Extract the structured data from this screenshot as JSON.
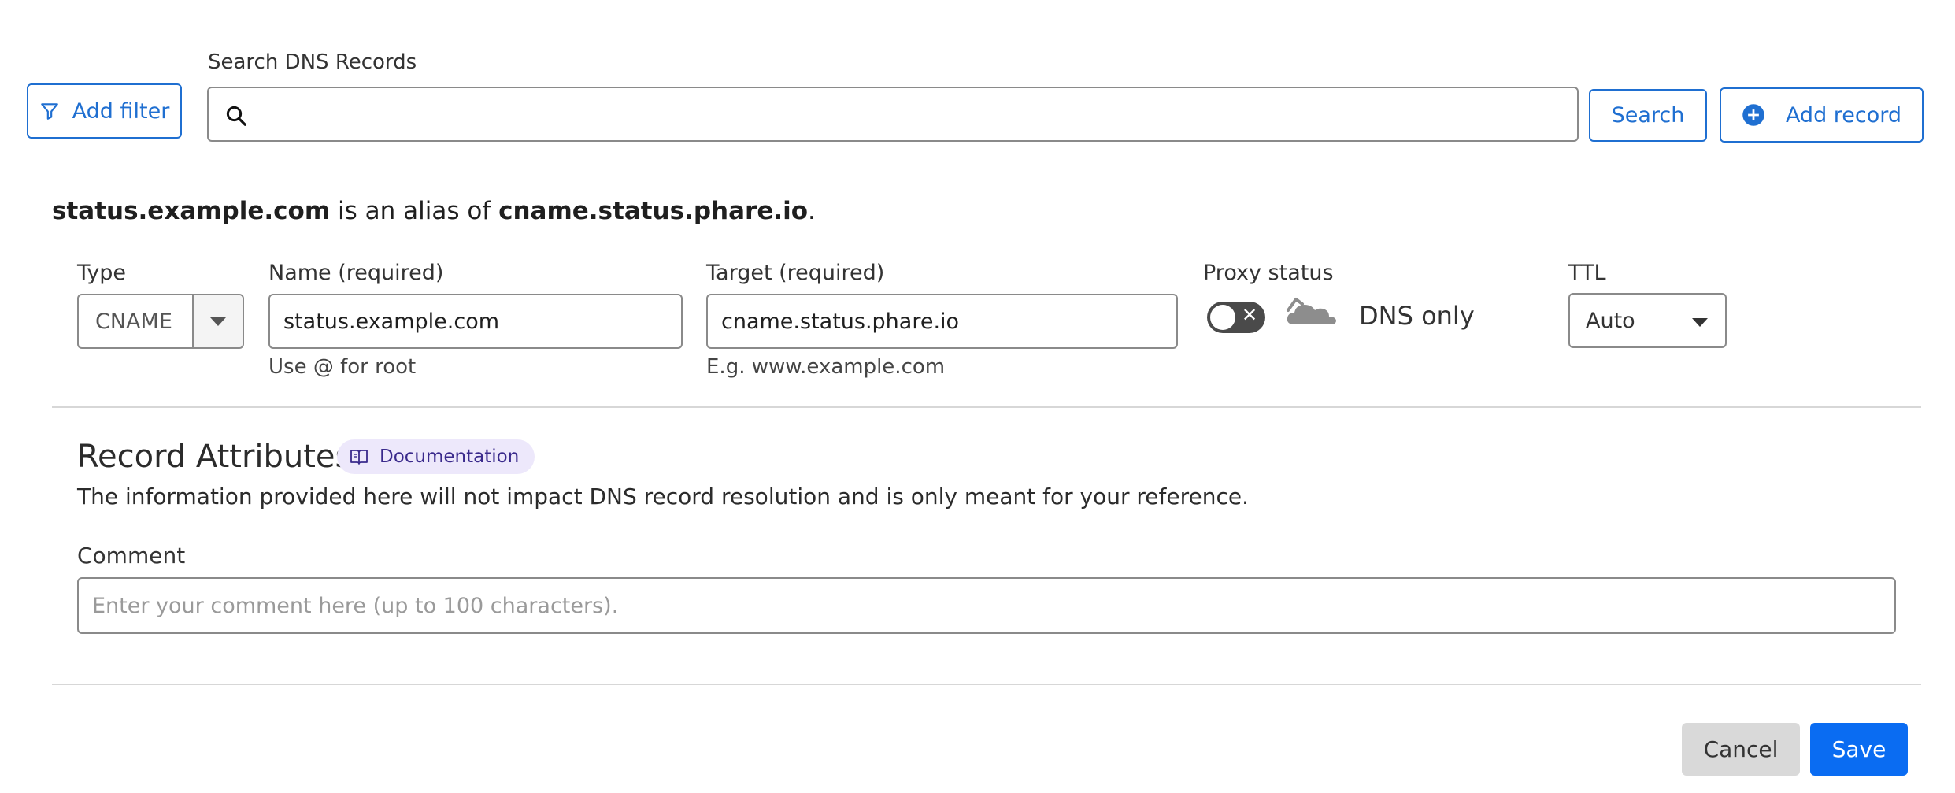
{
  "toolbar": {
    "add_filter_label": "Add filter",
    "search_label": "Search DNS Records",
    "search_value": "",
    "search_button_label": "Search",
    "add_record_label": "Add record"
  },
  "alias": {
    "host": "status.example.com",
    "middle_text": " is an alias of ",
    "target": "cname.status.phare.io",
    "end": "."
  },
  "record": {
    "type_label": "Type",
    "type_value": "CNAME",
    "name_label": "Name (required)",
    "name_value": "status.example.com",
    "name_hint": "Use @ for root",
    "target_label": "Target (required)",
    "target_value": "cname.status.phare.io",
    "target_hint": "E.g. www.example.com",
    "proxy_label": "Proxy status",
    "proxy_state_text": "DNS only",
    "proxy_enabled": false,
    "ttl_label": "TTL",
    "ttl_value": "Auto"
  },
  "attributes": {
    "title": "Record Attributes",
    "doc_label": "Documentation",
    "description": "The information provided here will not impact DNS record resolution and is only meant for your reference.",
    "comment_label": "Comment",
    "comment_placeholder": "Enter your comment here (up to 100 characters).",
    "comment_value": ""
  },
  "actions": {
    "cancel_label": "Cancel",
    "save_label": "Save"
  },
  "colors": {
    "accent": "#1f6fd1",
    "primary_button": "#0a6cf2",
    "doc_pill_bg": "#ede8fb"
  }
}
